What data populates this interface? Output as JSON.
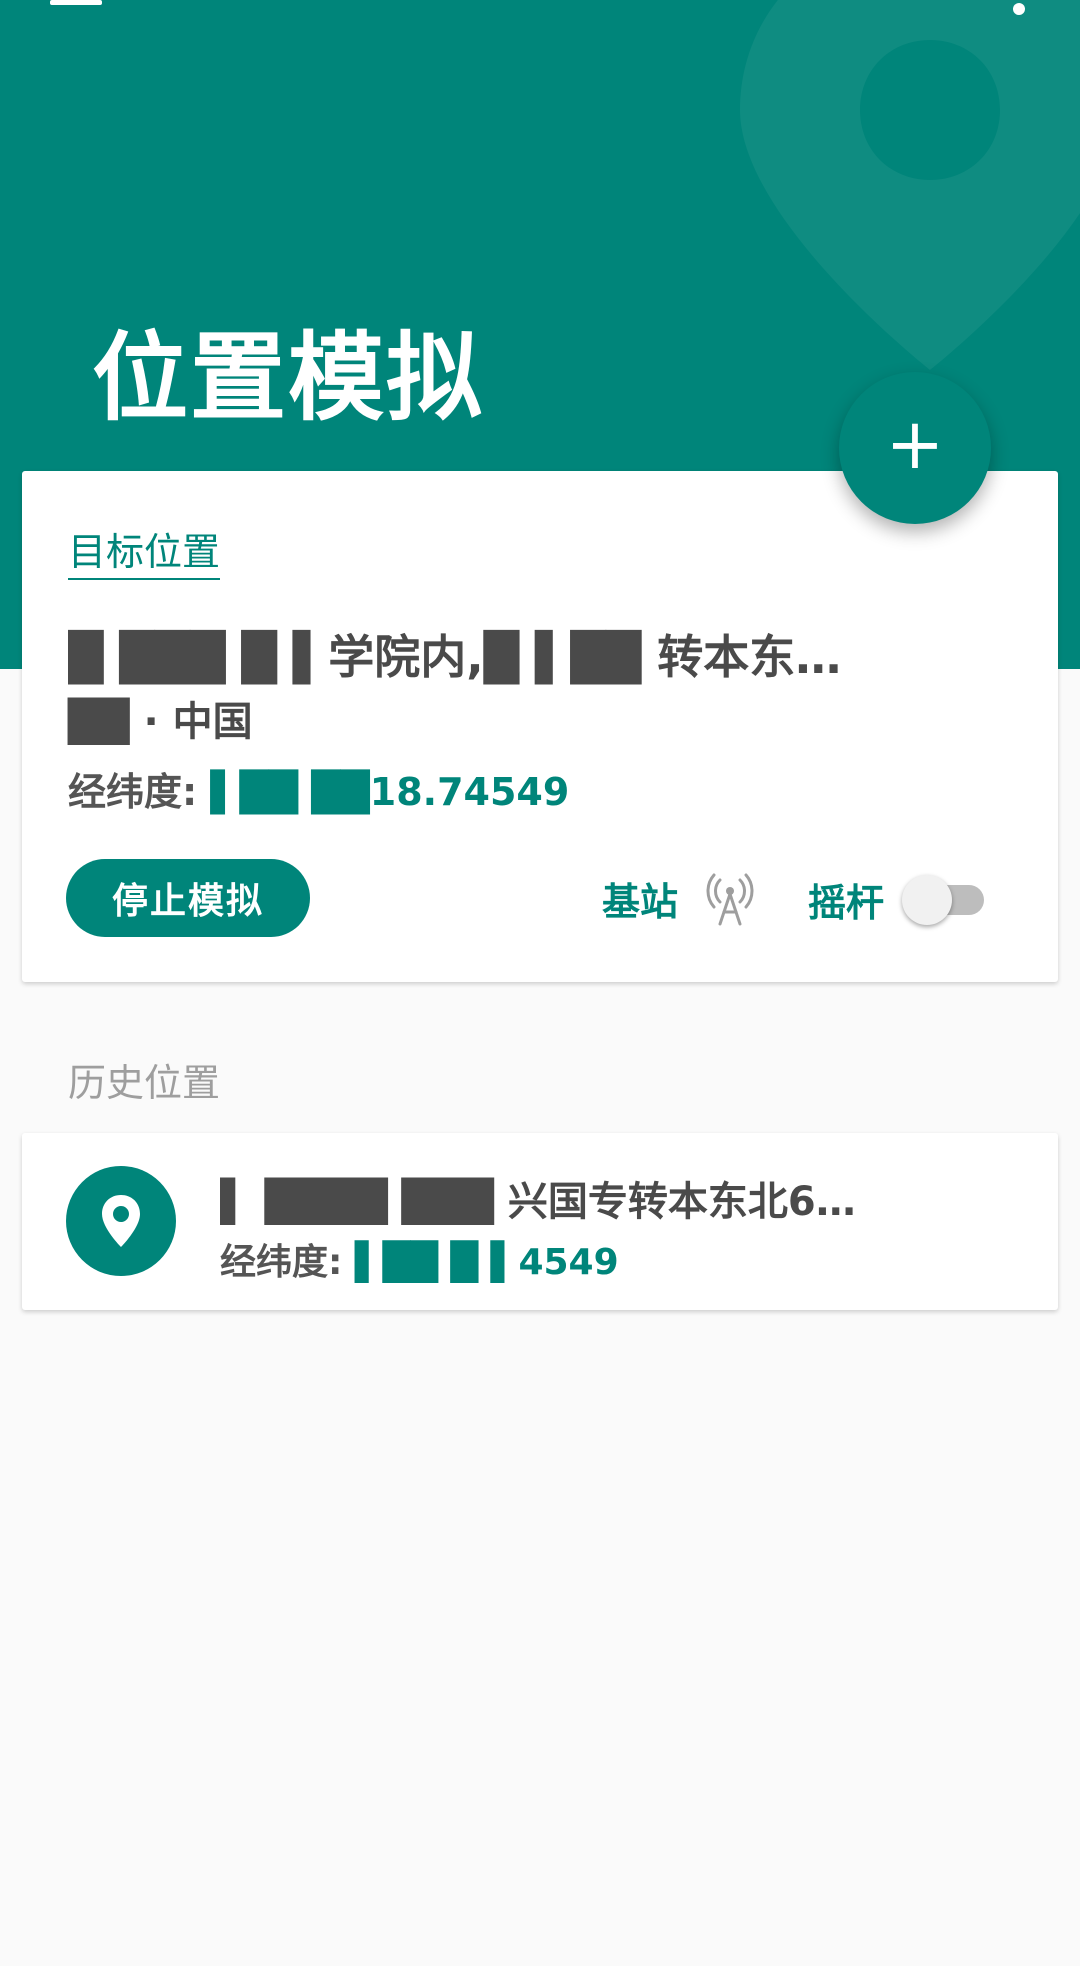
{
  "header": {
    "title": "位置模拟",
    "bg_color": "#00857a"
  },
  "fab": {
    "label": "+"
  },
  "target": {
    "section_label": "目标位置",
    "address_line1": "█ ███ █ ▌学院内,█ ▌██ 转本东…",
    "address_line2": "██ · 中国",
    "coords_label": "经纬度:",
    "coords_value": "▌██ ██18.74549",
    "stop_button": "停止模拟",
    "basestation_label": "基站",
    "joystick_label": "摇杆",
    "joystick_on": false
  },
  "history": {
    "section_label": "历史位置",
    "items": [
      {
        "address": "▌ ████ ███ 兴国专转本东北6…",
        "coords_label": "经纬度:",
        "coords_value": "▌██ █ ▌4549"
      }
    ]
  },
  "icons": {
    "menu": "hamburger-menu-icon",
    "overflow": "overflow-menu-icon",
    "add": "plus-icon",
    "basestation": "cell-tower-icon",
    "history_pin": "location-pin-icon"
  },
  "colors": {
    "accent": "#00857a",
    "text_dark": "#4a4a4a",
    "text_muted": "#9e9e9e"
  }
}
